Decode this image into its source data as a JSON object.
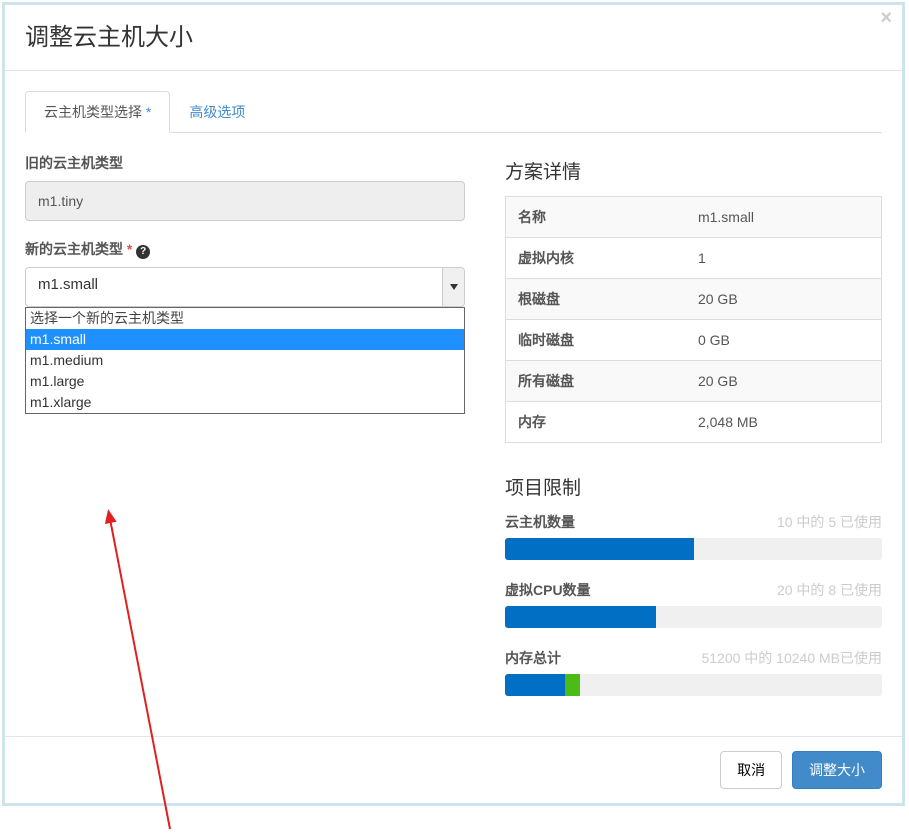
{
  "modal": {
    "title": "调整云主机大小",
    "close": "×"
  },
  "tabs": {
    "type_select": "云主机类型选择",
    "type_select_marker": "*",
    "advanced": "高级选项"
  },
  "form": {
    "old_flavor_label": "旧的云主机类型",
    "old_flavor_value": "m1.tiny",
    "new_flavor_label": "新的云主机类型",
    "required_marker": "*",
    "help_icon": "?",
    "new_flavor_selected": "m1.small",
    "dropdown": {
      "placeholder": "选择一个新的云主机类型",
      "options": [
        "m1.small",
        "m1.medium",
        "m1.large",
        "m1.xlarge"
      ]
    }
  },
  "details": {
    "heading": "方案详情",
    "rows": [
      {
        "label": "名称",
        "value": "m1.small"
      },
      {
        "label": "虚拟内核",
        "value": "1"
      },
      {
        "label": "根磁盘",
        "value": "20 GB"
      },
      {
        "label": "临时磁盘",
        "value": "0 GB"
      },
      {
        "label": "所有磁盘",
        "value": "20 GB"
      },
      {
        "label": "内存",
        "value": "2,048 MB"
      }
    ]
  },
  "limits": {
    "heading": "项目限制",
    "items": [
      {
        "label": "云主机数量",
        "usage": "10 中的 5 已使用",
        "pct": 50,
        "extra_pct": 0
      },
      {
        "label": "虚拟CPU数量",
        "usage": "20 中的 8 已使用",
        "pct": 40,
        "extra_pct": 0
      },
      {
        "label": "内存总计",
        "usage": "51200 中的 10240 MB已使用",
        "pct": 16,
        "extra_pct": 4
      }
    ]
  },
  "footer": {
    "cancel": "取消",
    "submit": "调整大小"
  }
}
